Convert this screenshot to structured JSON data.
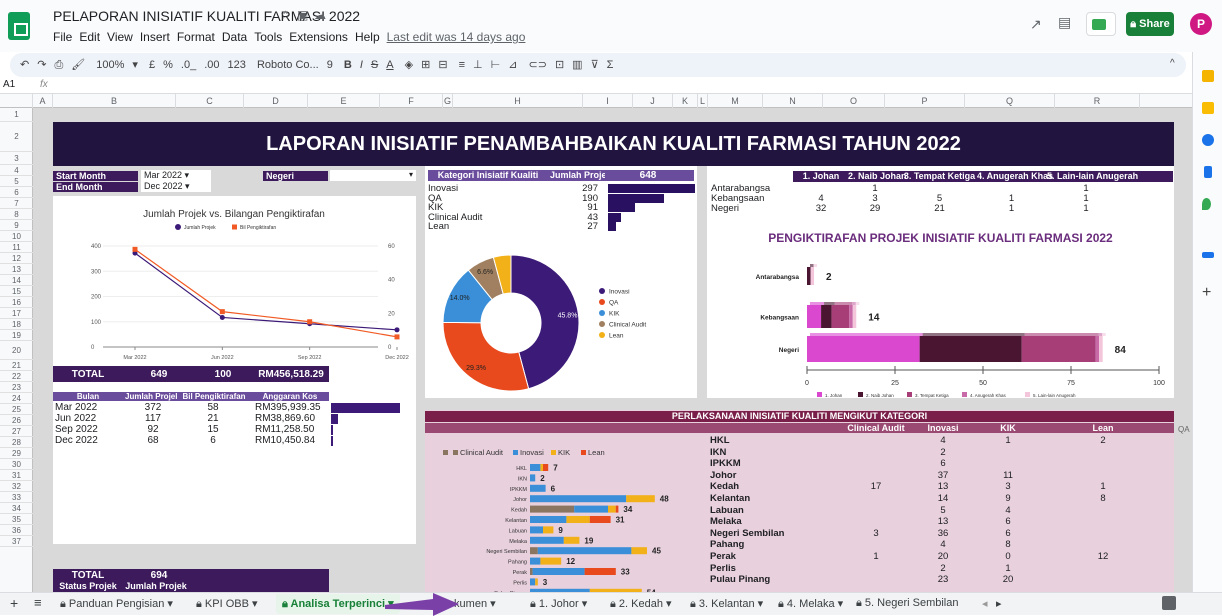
{
  "app": {
    "title": "PELAPORAN INISIATIF KUALITI FARMASI 2022",
    "menu": [
      "File",
      "Edit",
      "View",
      "Insert",
      "Format",
      "Data",
      "Tools",
      "Extensions",
      "Help"
    ],
    "last_edit": "Last edit was 14 days ago",
    "share_label": "Share",
    "avatar_letter": "P"
  },
  "toolbar": {
    "zoom": "100%",
    "currency": "£",
    "percent": "%",
    "dec_less": ".0_",
    "dec_more": ".00",
    "format": "123",
    "font": "Roboto Co...",
    "font_size": "9"
  },
  "formula": {
    "cell_ref": "A1",
    "fx": "fx"
  },
  "columns": [
    "A",
    "B",
    "C",
    "D",
    "E",
    "F",
    "G",
    "H",
    "I",
    "J",
    "K",
    "L",
    "M",
    "N",
    "O",
    "P",
    "Q",
    "R"
  ],
  "rows": [
    "1",
    "2",
    "3",
    "4",
    "5",
    "6",
    "7",
    "8",
    "9",
    "10",
    "11",
    "12",
    "13",
    "14",
    "15",
    "16",
    "17",
    "18",
    "19",
    "20",
    "21",
    "22",
    "23",
    "24",
    "25",
    "26",
    "27",
    "28",
    "29",
    "30",
    "31",
    "32",
    "33",
    "34",
    "35",
    "36",
    "37"
  ],
  "dashboard": {
    "banner": "LAPORAN INISIATIF PENAMBAHBAIKAN KUALITI FARMASI TAHUN 2022",
    "filters": {
      "start_label": "Start Month",
      "start_value": "Mar 2022",
      "end_label": "End Month",
      "end_value": "Dec 2022",
      "negeri_label": "Negeri",
      "negeri_value": ""
    },
    "line_chart": {
      "title": "Jumlah Projek vs. Bilangan Pengiktirafan",
      "legend": [
        "Jumlah Projek",
        "Bil Pengiktirafan"
      ],
      "left_ticks": [
        "400",
        "300",
        "200",
        "100",
        "0"
      ],
      "right_ticks": [
        "60",
        "40",
        "20",
        "0"
      ],
      "x_ticks": [
        "Mar 2022",
        "Jun 2022",
        "Sep 2022",
        "Dec 2022"
      ]
    },
    "totals": {
      "label": "TOTAL",
      "projek": "649",
      "pengiktirafan": "100",
      "kos": "RM456,518.29"
    },
    "monthly": {
      "headers": [
        "Bulan",
        "Jumlah Projek",
        "Bil Pengiktirafan",
        "Anggaran Kos"
      ],
      "rows": [
        [
          "Mar 2022",
          "372",
          "58",
          "RM395,939.35"
        ],
        [
          "Jun 2022",
          "117",
          "21",
          "RM38,869.60"
        ],
        [
          "Sep 2022",
          "92",
          "15",
          "RM11,258.50"
        ],
        [
          "Dec 2022",
          "68",
          "6",
          "RM10,450.84"
        ]
      ],
      "cost_share": [
        0.867,
        0.085,
        0.025,
        0.023
      ]
    },
    "status": {
      "total_label": "TOTAL",
      "total_value": "694",
      "col1": "Status Projek",
      "col2": "Jumlah Projek"
    },
    "kategori": {
      "header_cat": "Kategori Inisiatif Kualiti",
      "header_count": "Jumlah Projek",
      "header_total": "648",
      "rows": [
        [
          "Inovasi",
          "297"
        ],
        [
          "QA",
          "190"
        ],
        [
          "KIK",
          "91"
        ],
        [
          "Clinical Audit",
          "43"
        ],
        [
          "Lean",
          "27"
        ]
      ]
    },
    "pengiktirafan_table": {
      "headers": [
        "1. Johan",
        "2. Naib Johan",
        "3. Tempat Ketiga",
        "4. Anugerah Khas",
        "5. Lain-lain Anugerah"
      ],
      "rows": [
        {
          "label": "Antarabangsa",
          "values": [
            "",
            "1",
            "",
            "",
            "1"
          ]
        },
        {
          "label": "Kebangsaan",
          "values": [
            "4",
            "3",
            "5",
            "1",
            "1"
          ]
        },
        {
          "label": "Negeri",
          "values": [
            "32",
            "29",
            "21",
            "1",
            "1"
          ]
        }
      ]
    },
    "stacked_chart": {
      "title": "PENGIKTIRAFAN PROJEK INISIATIF KUALITI FARMASI 2022",
      "categories": [
        "Antarabangsa",
        "Kebangsaan",
        "Negeri"
      ],
      "totals": [
        "2",
        "14",
        "84"
      ],
      "x_ticks": [
        "0",
        "25",
        "50",
        "75",
        "100"
      ],
      "legend": [
        "1. Johan",
        "2. Naib Johan",
        "3. Tempat Ketiga",
        "4. Anugerah Khas",
        "5. Lain-lain Anugerah"
      ]
    },
    "pie_labels": [
      "6.6%",
      "14.0%",
      "45.8%",
      "29.3%"
    ],
    "pie_legend": [
      "Inovasi",
      "QA",
      "KIK",
      "Clinical Audit",
      "Lean"
    ],
    "pelaksanaan": {
      "title": "PERLAKSANAAN INISIATIF KUALITI MENGIKUT KATEGORI",
      "headers": [
        "Clinical Audit",
        "Inovasi",
        "KIK",
        "Lean"
      ],
      "extra_header": "QA",
      "legend": [
        "Clinical Audit",
        "Inovasi",
        "KIK",
        "Lean"
      ],
      "rows": [
        {
          "name": "HKL",
          "ca": "",
          "ino": "4",
          "kik": "1",
          "lean": "2"
        },
        {
          "name": "IKN",
          "ca": "",
          "ino": "2",
          "kik": "",
          "lean": ""
        },
        {
          "name": "IPKKM",
          "ca": "",
          "ino": "6",
          "kik": "",
          "lean": ""
        },
        {
          "name": "Johor",
          "ca": "",
          "ino": "37",
          "kik": "11",
          "lean": ""
        },
        {
          "name": "Kedah",
          "ca": "17",
          "ino": "13",
          "kik": "3",
          "lean": "1"
        },
        {
          "name": "Kelantan",
          "ca": "",
          "ino": "14",
          "kik": "9",
          "lean": "8"
        },
        {
          "name": "Labuan",
          "ca": "",
          "ino": "5",
          "kik": "4",
          "lean": ""
        },
        {
          "name": "Melaka",
          "ca": "",
          "ino": "13",
          "kik": "6",
          "lean": ""
        },
        {
          "name": "Negeri Sembilan",
          "ca": "3",
          "ino": "36",
          "kik": "6",
          "lean": ""
        },
        {
          "name": "Pahang",
          "ca": "",
          "ino": "4",
          "kik": "8",
          "lean": ""
        },
        {
          "name": "Perak",
          "ca": "1",
          "ino": "20",
          "kik": "0",
          "lean": "12"
        },
        {
          "name": "Perlis",
          "ca": "",
          "ino": "2",
          "kik": "1",
          "lean": ""
        },
        {
          "name": "Pulau Pinang",
          "ca": "",
          "ino": "23",
          "kik": "20",
          "lean": ""
        }
      ],
      "bar_totals": [
        "7",
        "2",
        "6",
        "48",
        "34",
        "31",
        "9",
        "19",
        "45",
        "12",
        "33",
        "3",
        "54"
      ]
    }
  },
  "tabs": [
    "Panduan Pengisian",
    "KPI OBB",
    "Analisa Terperinci",
    "Dokumen",
    "1. Johor",
    "2. Kedah",
    "3. Kelantan",
    "4. Melaka",
    "5. Negeri Sembilan"
  ],
  "chart_data": [
    {
      "type": "line",
      "title": "Jumlah Projek vs. Bilangan Pengiktirafan",
      "x": [
        "Mar 2022",
        "Jun 2022",
        "Sep 2022",
        "Dec 2022"
      ],
      "series": [
        {
          "name": "Jumlah Projek",
          "values": [
            372,
            117,
            92,
            68
          ],
          "color": "#3c1a78",
          "axis": "left"
        },
        {
          "name": "Bil Pengiktirafan",
          "values": [
            58,
            21,
            15,
            6
          ],
          "color": "#f15a24",
          "axis": "right"
        }
      ],
      "ylim": [
        0,
        400
      ],
      "y2lim": [
        0,
        60
      ]
    },
    {
      "type": "pie",
      "labels": [
        "Inovasi",
        "QA",
        "KIK",
        "Clinical Audit",
        "Lean"
      ],
      "values": [
        297,
        190,
        91,
        43,
        27
      ],
      "percent_labels": [
        "45.8%",
        "29.3%",
        "14.0%",
        "6.6%",
        ""
      ],
      "colors": [
        "#3c1a78",
        "#e8491d",
        "#3a8fd8",
        "#a08060",
        "#f2b019"
      ]
    },
    {
      "type": "bar",
      "title": "PENGIKTIRAFAN PROJEK INISIATIF KUALITI FARMASI 2022",
      "categories": [
        "Antarabangsa",
        "Kebangsaan",
        "Negeri"
      ],
      "series": [
        {
          "name": "1. Johan",
          "values": [
            0,
            4,
            32
          ],
          "color": "#d948cf"
        },
        {
          "name": "2. Naib Johan",
          "values": [
            1,
            3,
            29
          ],
          "color": "#4a1530"
        },
        {
          "name": "3. Tempat Ketiga",
          "values": [
            0,
            5,
            21
          ],
          "color": "#a83e78"
        },
        {
          "name": "4. Anugerah Khas",
          "values": [
            0,
            1,
            1
          ],
          "color": "#c86aa8"
        },
        {
          "name": "5. Lain-lain Anugerah",
          "values": [
            1,
            1,
            1
          ],
          "color": "#f3c6dc"
        }
      ],
      "xlim": [
        0,
        100
      ]
    },
    {
      "type": "bar",
      "categories": [
        "HKL",
        "IKN",
        "IPKKM",
        "Johor",
        "Kedah",
        "Kelantan",
        "Labuan",
        "Melaka",
        "Negeri Sembilan",
        "Pahang",
        "Perak",
        "Perlis",
        "Pulau Pinang"
      ],
      "series": [
        {
          "name": "QA",
          "values": [
            0,
            0,
            0,
            0,
            0,
            0,
            0,
            0,
            0,
            0,
            0,
            0,
            0
          ],
          "color": "#3c1a78"
        },
        {
          "name": "Clinical Audit",
          "values": [
            0,
            0,
            0,
            0,
            17,
            0,
            0,
            0,
            3,
            0,
            1,
            0,
            0
          ],
          "color": "#8a7560"
        },
        {
          "name": "Inovasi",
          "values": [
            4,
            2,
            6,
            37,
            13,
            14,
            5,
            13,
            36,
            4,
            20,
            2,
            23
          ],
          "color": "#3a8fd8"
        },
        {
          "name": "KIK",
          "values": [
            1,
            0,
            0,
            11,
            3,
            9,
            4,
            6,
            6,
            8,
            0,
            1,
            20
          ],
          "color": "#f2b019"
        },
        {
          "name": "Lean",
          "values": [
            2,
            0,
            0,
            0,
            1,
            8,
            0,
            0,
            0,
            0,
            12,
            0,
            0
          ],
          "color": "#e8491d"
        }
      ],
      "totals": [
        7,
        2,
        6,
        48,
        34,
        31,
        9,
        19,
        45,
        12,
        33,
        3,
        54
      ]
    }
  ]
}
